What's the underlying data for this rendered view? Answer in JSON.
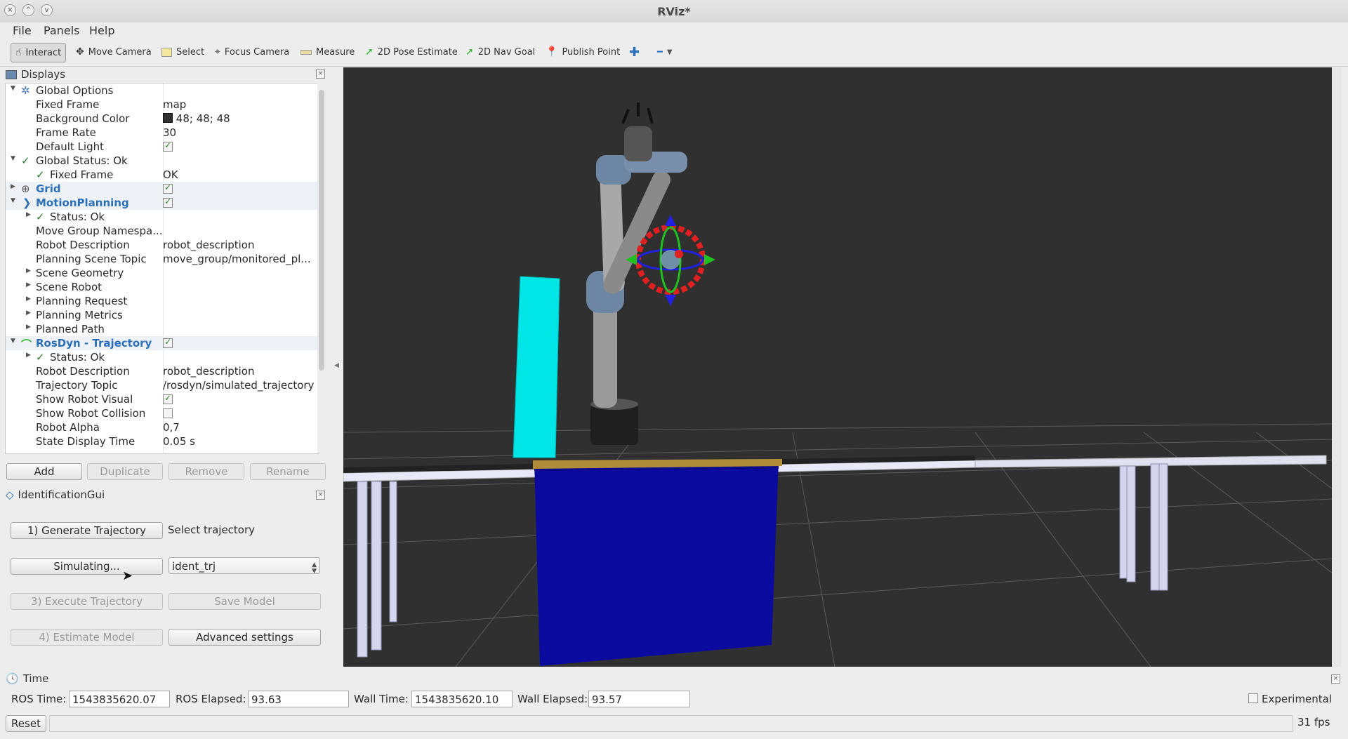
{
  "window": {
    "title": "RViz*"
  },
  "menu": [
    "File",
    "Panels",
    "Help"
  ],
  "toolbar": {
    "tools": [
      {
        "label": "Interact",
        "icon": "hand-icon"
      },
      {
        "label": "Move Camera",
        "icon": "move-camera-icon"
      },
      {
        "label": "Select",
        "icon": "select-icon"
      },
      {
        "label": "Focus Camera",
        "icon": "focus-icon"
      },
      {
        "label": "Measure",
        "icon": "ruler-icon"
      },
      {
        "label": "2D Pose Estimate",
        "icon": "green-arrow-icon"
      },
      {
        "label": "2D Nav Goal",
        "icon": "green-arrow-icon"
      },
      {
        "label": "Publish Point",
        "icon": "map-pin-icon"
      }
    ]
  },
  "displays": {
    "title": "Displays",
    "rows": [
      {
        "key": "Global Options",
        "value": ""
      },
      {
        "key": "Fixed Frame",
        "value": "map"
      },
      {
        "key": "Background Color",
        "value": "48; 48; 48"
      },
      {
        "key": "Frame Rate",
        "value": "30"
      },
      {
        "key": "Default Light",
        "value": ""
      },
      {
        "key": "Global Status: Ok",
        "value": ""
      },
      {
        "key": "Fixed Frame",
        "value": "OK"
      },
      {
        "key": "Grid",
        "value": ""
      },
      {
        "key": "MotionPlanning",
        "value": ""
      },
      {
        "key": "Status: Ok",
        "value": ""
      },
      {
        "key": "Move Group Namespa...",
        "value": ""
      },
      {
        "key": "Robot Description",
        "value": "robot_description"
      },
      {
        "key": "Planning Scene Topic",
        "value": "move_group/monitored_pl..."
      },
      {
        "key": "Scene Geometry",
        "value": ""
      },
      {
        "key": "Scene Robot",
        "value": ""
      },
      {
        "key": "Planning Request",
        "value": ""
      },
      {
        "key": "Planning Metrics",
        "value": ""
      },
      {
        "key": "Planned Path",
        "value": ""
      },
      {
        "key": "RosDyn - Trajectory",
        "value": ""
      },
      {
        "key": "Status: Ok",
        "value": ""
      },
      {
        "key": "Robot Description",
        "value": "robot_description"
      },
      {
        "key": "Trajectory Topic",
        "value": "/rosdyn/simulated_trajectory"
      },
      {
        "key": "Show Robot Visual",
        "value": ""
      },
      {
        "key": "Show Robot Collision",
        "value": ""
      },
      {
        "key": "Robot Alpha",
        "value": "0,7"
      },
      {
        "key": "State Display Time",
        "value": "0.05 s"
      }
    ],
    "buttons": [
      "Add",
      "Duplicate",
      "Remove",
      "Rename"
    ]
  },
  "ident": {
    "title": "IdentificationGui",
    "generate": "1) Generate Trajectory",
    "select_label": "Select trajectory",
    "simulating": "Simulating...",
    "trajectory_value": "ident_trj",
    "execute": "3) Execute Trajectory",
    "save_model": "Save Model",
    "estimate": "4) Estimate Model",
    "advanced": "Advanced settings"
  },
  "time": {
    "title": "Time",
    "ros_time_label": "ROS Time:",
    "ros_time": "1543835620.07",
    "ros_elapsed_label": "ROS Elapsed:",
    "ros_elapsed": "93.63",
    "wall_time_label": "Wall Time:",
    "wall_time": "1543835620.10",
    "wall_elapsed_label": "Wall Elapsed:",
    "wall_elapsed": "93.57",
    "experimental": "Experimental"
  },
  "status": {
    "reset": "Reset",
    "fps": "31 fps"
  },
  "colors": {
    "background": "#303030",
    "accent_blue": "#2a6fb8",
    "cyan_obstacle": "#00e5e5",
    "blue_table": "#0a0a9e"
  }
}
